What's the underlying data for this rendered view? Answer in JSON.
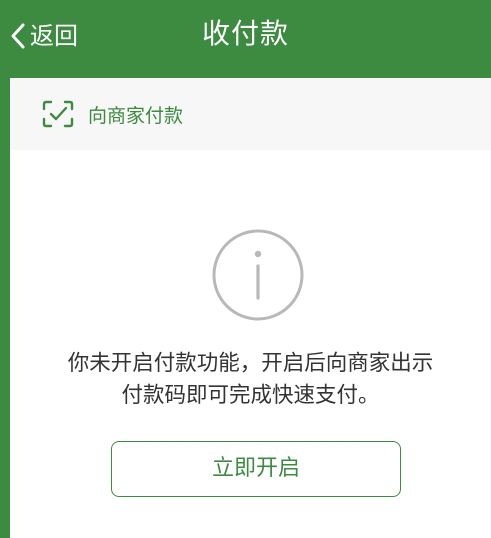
{
  "header": {
    "back_label": "返回",
    "title": "收付款"
  },
  "pay_merchant": {
    "label": "向商家付款",
    "icon": "scan-icon"
  },
  "notice": {
    "icon": "info-icon",
    "line1": "你未开启付款功能，开启后向商家出示",
    "line2": "付款码即可完成快速支付。"
  },
  "enable_button": {
    "label": "立即开启"
  },
  "colors": {
    "brand_green": "#3d8a41",
    "text_dark": "#333333",
    "icon_gray": "#b8b8b8",
    "row_bg": "#f7f7f7"
  }
}
